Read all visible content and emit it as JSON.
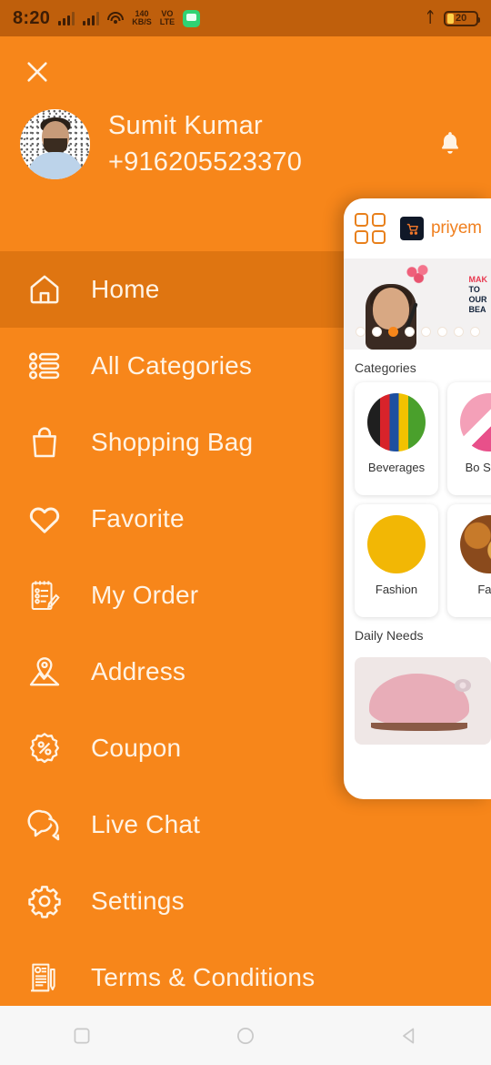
{
  "statusbar": {
    "time": "8:20",
    "network_speed": "140",
    "network_speed_unit": "KB/S",
    "volte_line1": "VO",
    "volte_line2": "LTE",
    "battery_percent": "20",
    "icons": [
      "signal-bars-icon",
      "signal-bars-icon",
      "wifi-icon",
      "data-speed-icon",
      "volte-icon",
      "message-icon",
      "bluetooth-icon",
      "battery-icon"
    ]
  },
  "drawer": {
    "close_label": "×",
    "profile": {
      "name": "Sumit Kumar",
      "phone": "+916205523370"
    },
    "notification_icon": "bell-icon",
    "items": [
      {
        "label": "Home",
        "icon": "home-icon",
        "active": true
      },
      {
        "label": "All Categories",
        "icon": "list-icon",
        "active": false
      },
      {
        "label": "Shopping Bag",
        "icon": "bag-icon",
        "active": false
      },
      {
        "label": "Favorite",
        "icon": "heart-icon",
        "active": false
      },
      {
        "label": "My Order",
        "icon": "order-icon",
        "active": false
      },
      {
        "label": "Address",
        "icon": "location-icon",
        "active": false
      },
      {
        "label": "Coupon",
        "icon": "coupon-icon",
        "active": false
      },
      {
        "label": "Live Chat",
        "icon": "chat-icon",
        "active": false
      },
      {
        "label": "Settings",
        "icon": "gear-icon",
        "active": false
      },
      {
        "label": "Terms & Conditions",
        "icon": "document-icon",
        "active": false
      }
    ]
  },
  "app_panel": {
    "grid_icon": "grid-icon",
    "brand_logo_icon": "cart-logo-icon",
    "brand_name": "priyem",
    "banner": {
      "headline_accent": "MAK",
      "headline_line1": "TO ",
      "headline_line2": "OUR",
      "headline_line3": "BEA",
      "dot_count": 8,
      "active_dot": 3
    },
    "categories_title": "Categories",
    "categories": [
      {
        "name": "Beverages"
      },
      {
        "name": "Bo\nStatio"
      },
      {
        "name": "Fashion"
      },
      {
        "name": "Fast"
      }
    ],
    "daily_needs_title": "Daily Needs"
  },
  "navbar": {
    "recents_label": "recents-icon",
    "home_label": "home-circle-icon",
    "back_label": "back-icon"
  },
  "colors": {
    "brand_orange": "#F7861A",
    "status_bar": "#BF5F0C",
    "active_row": "#DF7511",
    "text_cream": "#FFF3E4",
    "accent": "#F08020"
  }
}
